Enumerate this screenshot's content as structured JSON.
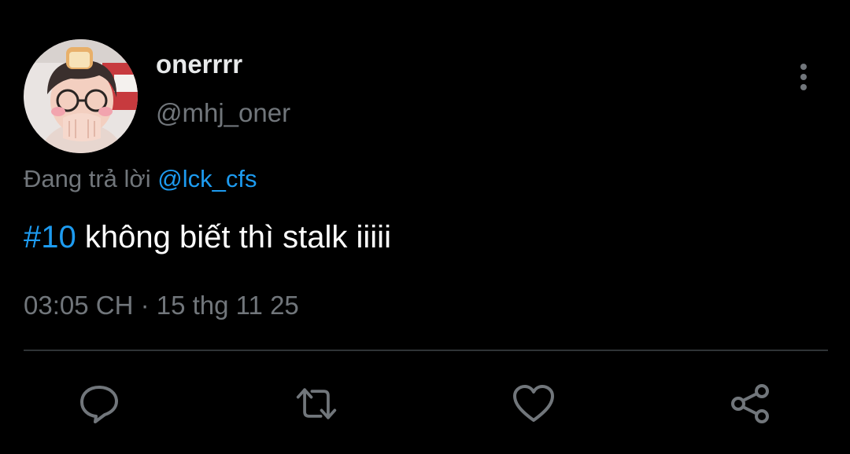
{
  "author": {
    "display_name": "onerrrr",
    "handle": "@mhj_oner",
    "avatar": "avatar"
  },
  "reply": {
    "prefix": "Đang trả lời",
    "mention": "@lck_cfs"
  },
  "tweet": {
    "hashtag": "#10",
    "text": "không biết thì stalk iiiii"
  },
  "timestamp": "03:05 CH · 15 thg 11 25",
  "icons": {
    "more": "more-vertical-icon",
    "reply": "reply-icon",
    "retweet": "retweet-icon",
    "like": "heart-icon",
    "share": "share-icon"
  },
  "colors": {
    "background": "#000000",
    "accent": "#1d9bf0",
    "muted": "#71767b",
    "text": "#ffffff",
    "divider": "#2f3336"
  }
}
